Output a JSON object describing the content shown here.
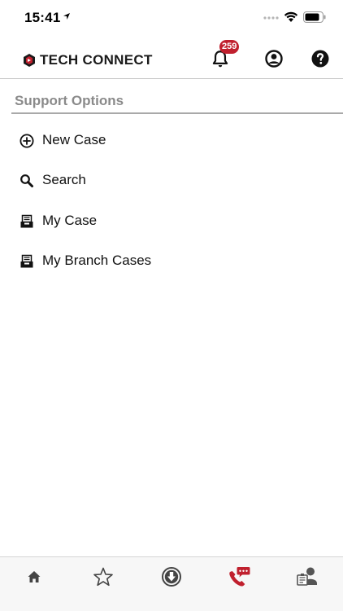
{
  "status_bar": {
    "time": "15:41"
  },
  "header": {
    "brand": "TECH CONNECT",
    "notification_count": "259",
    "accent_color": "#c0202e"
  },
  "support": {
    "title": "Support Options",
    "items": [
      {
        "label": "New Case",
        "icon": "plus-circle-icon"
      },
      {
        "label": "Search",
        "icon": "search-icon"
      },
      {
        "label": "My Case",
        "icon": "case-tray-icon"
      },
      {
        "label": "My Branch Cases",
        "icon": "case-tray-icon"
      }
    ]
  },
  "tab_bar": {
    "tabs": [
      {
        "icon": "home-icon",
        "active": false
      },
      {
        "icon": "star-icon",
        "active": false
      },
      {
        "icon": "download-icon",
        "active": false
      },
      {
        "icon": "phone-chat-icon",
        "active": true
      },
      {
        "icon": "technician-icon",
        "active": false
      }
    ]
  }
}
